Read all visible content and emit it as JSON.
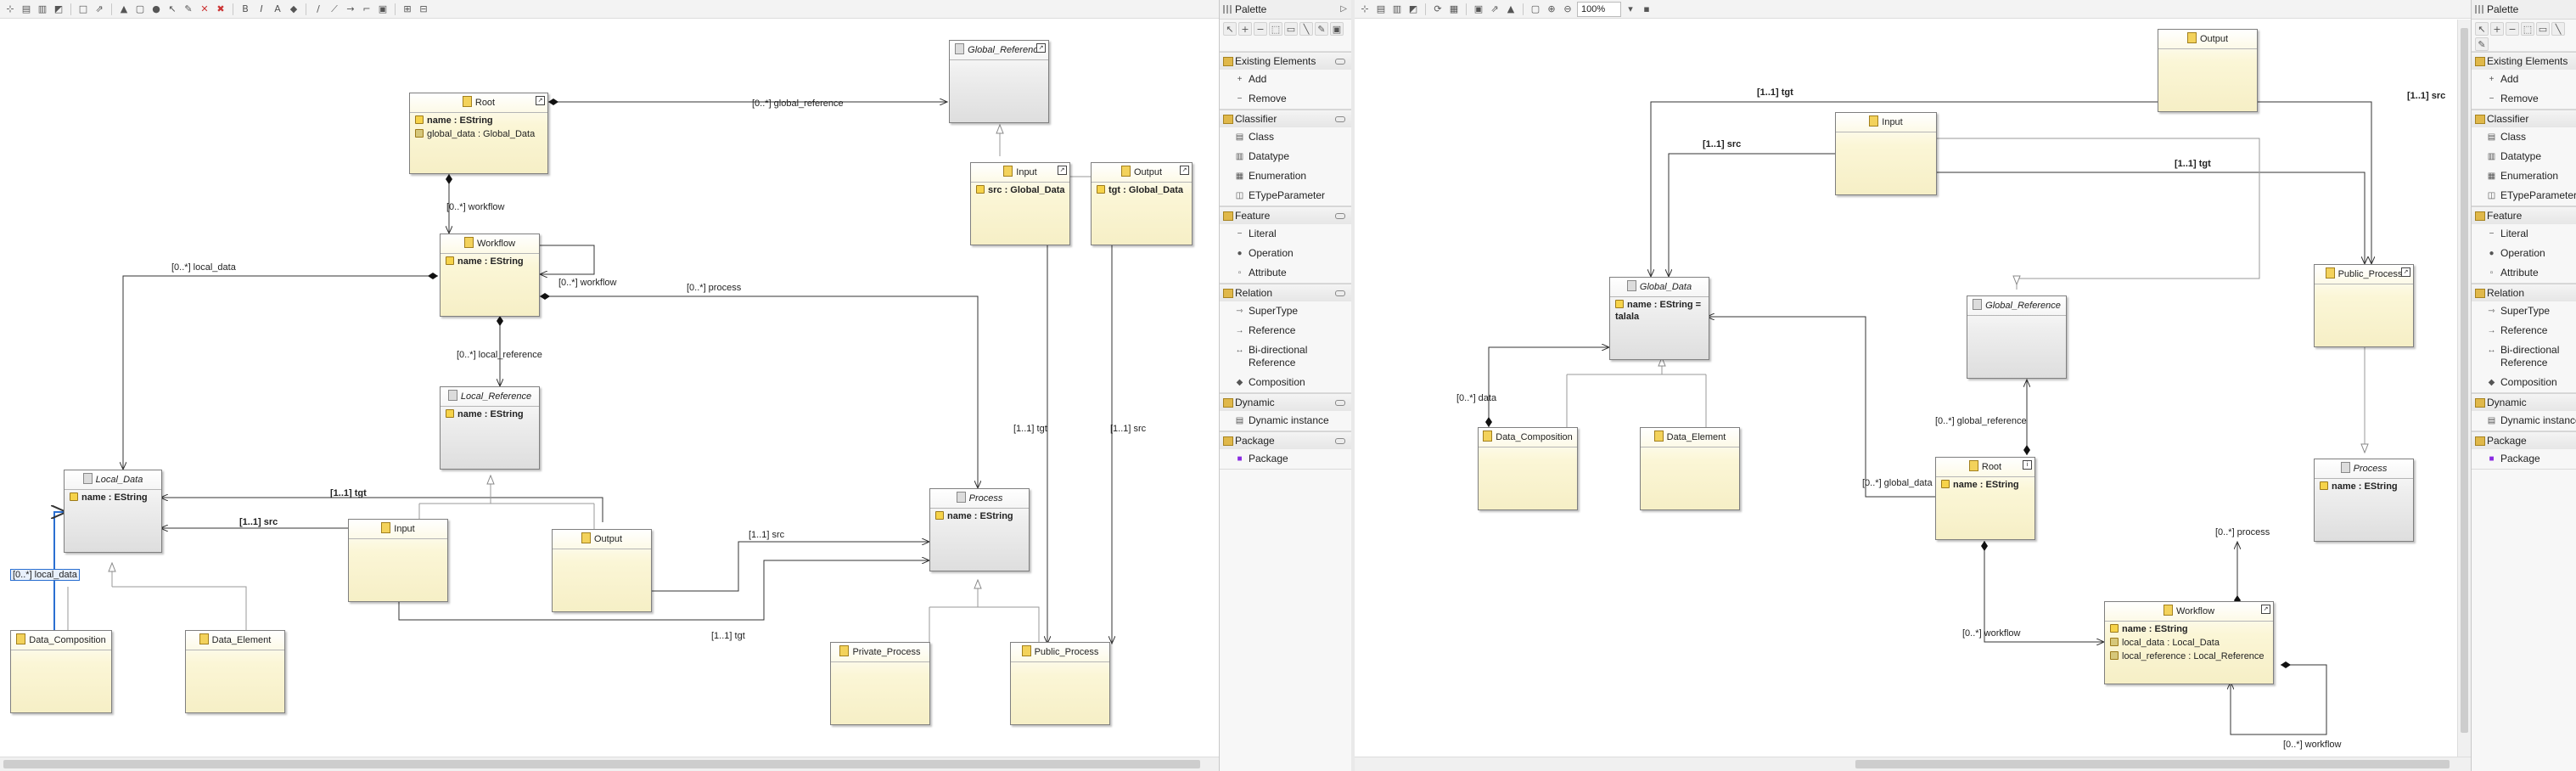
{
  "toolbar": {
    "zoom": "100%"
  },
  "palette": {
    "title": "Palette",
    "drawers": [
      {
        "label": "Existing Elements",
        "items": [
          {
            "label": "Add",
            "icon": "plus-icon"
          },
          {
            "label": "Remove",
            "icon": "minus-icon"
          }
        ]
      },
      {
        "label": "Classifier",
        "items": [
          {
            "label": "Class",
            "icon": "class-icon"
          },
          {
            "label": "Datatype",
            "icon": "datatype-icon"
          },
          {
            "label": "Enumeration",
            "icon": "enumeration-icon"
          },
          {
            "label": "ETypeParameter",
            "icon": "type-parameter-icon"
          }
        ]
      },
      {
        "label": "Feature",
        "items": [
          {
            "label": "Literal",
            "icon": "literal-icon"
          },
          {
            "label": "Operation",
            "icon": "operation-icon"
          },
          {
            "label": "Attribute",
            "icon": "attribute-icon"
          }
        ]
      },
      {
        "label": "Relation",
        "items": [
          {
            "label": "SuperType",
            "icon": "supertype-icon"
          },
          {
            "label": "Reference",
            "icon": "reference-icon"
          },
          {
            "label": "Bi-directional Reference",
            "icon": "bidirectional-reference-icon"
          },
          {
            "label": "Composition",
            "icon": "composition-icon"
          }
        ]
      },
      {
        "label": "Dynamic",
        "items": [
          {
            "label": "Dynamic instance",
            "icon": "dynamic-instance-icon"
          }
        ]
      },
      {
        "label": "Package",
        "items": [
          {
            "label": "Package",
            "icon": "package-icon"
          }
        ]
      }
    ]
  },
  "left_diagram": {
    "classes": {
      "root": {
        "name": "Root",
        "attrs": [
          [
            "name : ",
            "EString"
          ],
          [
            "global_data : Global_Data",
            ""
          ]
        ]
      },
      "global_reference": {
        "name": "Global_Reference"
      },
      "input_top": {
        "name": "Input",
        "attrs": [
          [
            "src : ",
            "Global_Data"
          ]
        ]
      },
      "output_top": {
        "name": "Output",
        "attrs": [
          [
            "tgt : ",
            "Global_Data"
          ]
        ]
      },
      "workflow": {
        "name": "Workflow",
        "attrs": [
          [
            "name : ",
            "EString"
          ]
        ]
      },
      "local_reference": {
        "name": "Local_Reference",
        "attrs": [
          [
            "name : ",
            "EString"
          ]
        ]
      },
      "local_data": {
        "name": "Local_Data",
        "attrs": [
          [
            "name : ",
            "EString"
          ]
        ]
      },
      "input": {
        "name": "Input"
      },
      "output": {
        "name": "Output"
      },
      "process": {
        "name": "Process",
        "attrs": [
          [
            "name : ",
            "EString"
          ]
        ]
      },
      "data_composition": {
        "name": "Data_Composition"
      },
      "data_element": {
        "name": "Data_Element"
      },
      "private_process": {
        "name": "Private_Process"
      },
      "public_process": {
        "name": "Public_Process"
      }
    },
    "labels": {
      "global_reference": "[0..*] global_reference",
      "workflow": "[0..*] workflow",
      "workflow_self": "[0..*] workflow",
      "local_data": "[0..*] local_data",
      "process": "[0..*] process",
      "local_reference": "[0..*] local_reference",
      "tgt_top": "[1..1] tgt",
      "src_top": "[1..1] src",
      "tgt1": "[1..1] tgt",
      "src1": "[1..1] src",
      "src2": "[1..1] src",
      "tgt2": "[1..1] tgt",
      "local_data_sel": "[0..*] local_data"
    }
  },
  "right_diagram": {
    "classes": {
      "output": {
        "name": "Output"
      },
      "input": {
        "name": "Input"
      },
      "global_data": {
        "name": "Global_Data",
        "attrs": [
          [
            "name : EString = ",
            "talala"
          ]
        ]
      },
      "global_reference": {
        "name": "Global_Reference"
      },
      "public_process": {
        "name": "Public_Process"
      },
      "data_composition": {
        "name": "Data_Composition"
      },
      "data_element": {
        "name": "Data_Element"
      },
      "root": {
        "name": "Root",
        "attrs": [
          [
            "name : ",
            "EString"
          ]
        ]
      },
      "process": {
        "name": "Process",
        "attrs": [
          [
            "name : ",
            "EString"
          ]
        ]
      },
      "workflow": {
        "name": "Workflow",
        "attrs": [
          [
            "name : ",
            "EString"
          ],
          [
            "local_data : Local_Data",
            ""
          ],
          [
            "local_reference : Local_Reference",
            ""
          ]
        ]
      }
    },
    "labels": {
      "tgt_a": "[1..1] tgt",
      "src_a": "[1..1] src",
      "tgt_b": "[1..1] tgt",
      "src_b": "[1..1] src",
      "data": "[0..*] data",
      "global_reference": "[0..*] global_reference",
      "global_data": "[0..*] global_data",
      "process": "[0..*] process",
      "workflow": "[0..*] workflow",
      "workflow_self": "[0..*] workflow"
    }
  }
}
